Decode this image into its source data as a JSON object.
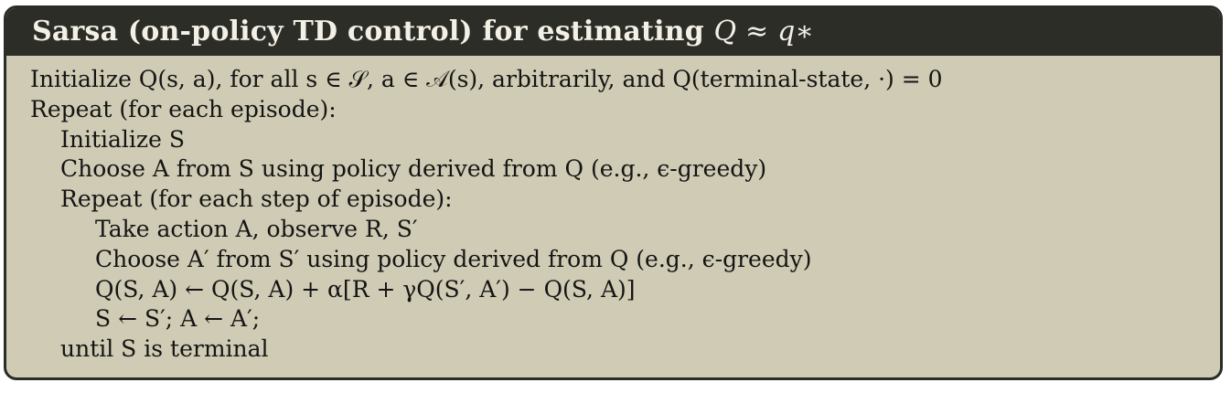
{
  "header": {
    "title_prefix": "Sarsa (on-policy TD control) for estimating ",
    "title_math": "Q ≈ q∗"
  },
  "lines": [
    {
      "text": "Initialize Q(s, a), for all s ∈ 𝒮, a ∈ 𝒜(s), arbitrarily, and Q(terminal-state, ·) = 0",
      "indent": 0
    },
    {
      "text": "Repeat (for each episode):",
      "indent": 0
    },
    {
      "text": "Initialize S",
      "indent": 1
    },
    {
      "text": "Choose A from S using policy derived from Q (e.g., ϵ-greedy)",
      "indent": 1
    },
    {
      "text": "Repeat (for each step of episode):",
      "indent": 1
    },
    {
      "text": "Take action A, observe R, S′",
      "indent": 2
    },
    {
      "text": "Choose A′ from S′ using policy derived from Q (e.g., ϵ-greedy)",
      "indent": 2
    },
    {
      "text": "Q(S, A) ← Q(S, A) + α[R + γQ(S′, A′) − Q(S, A)]",
      "indent": 2
    },
    {
      "text": "S ← S′; A ← A′;",
      "indent": 2
    },
    {
      "text": "until S is terminal",
      "indent": 1
    }
  ],
  "colors": {
    "box_background": "#cfcbb4",
    "header_background": "#2d2d28",
    "header_text": "#f3f0e6",
    "border": "#2b2b27",
    "body_text": "#141414"
  }
}
